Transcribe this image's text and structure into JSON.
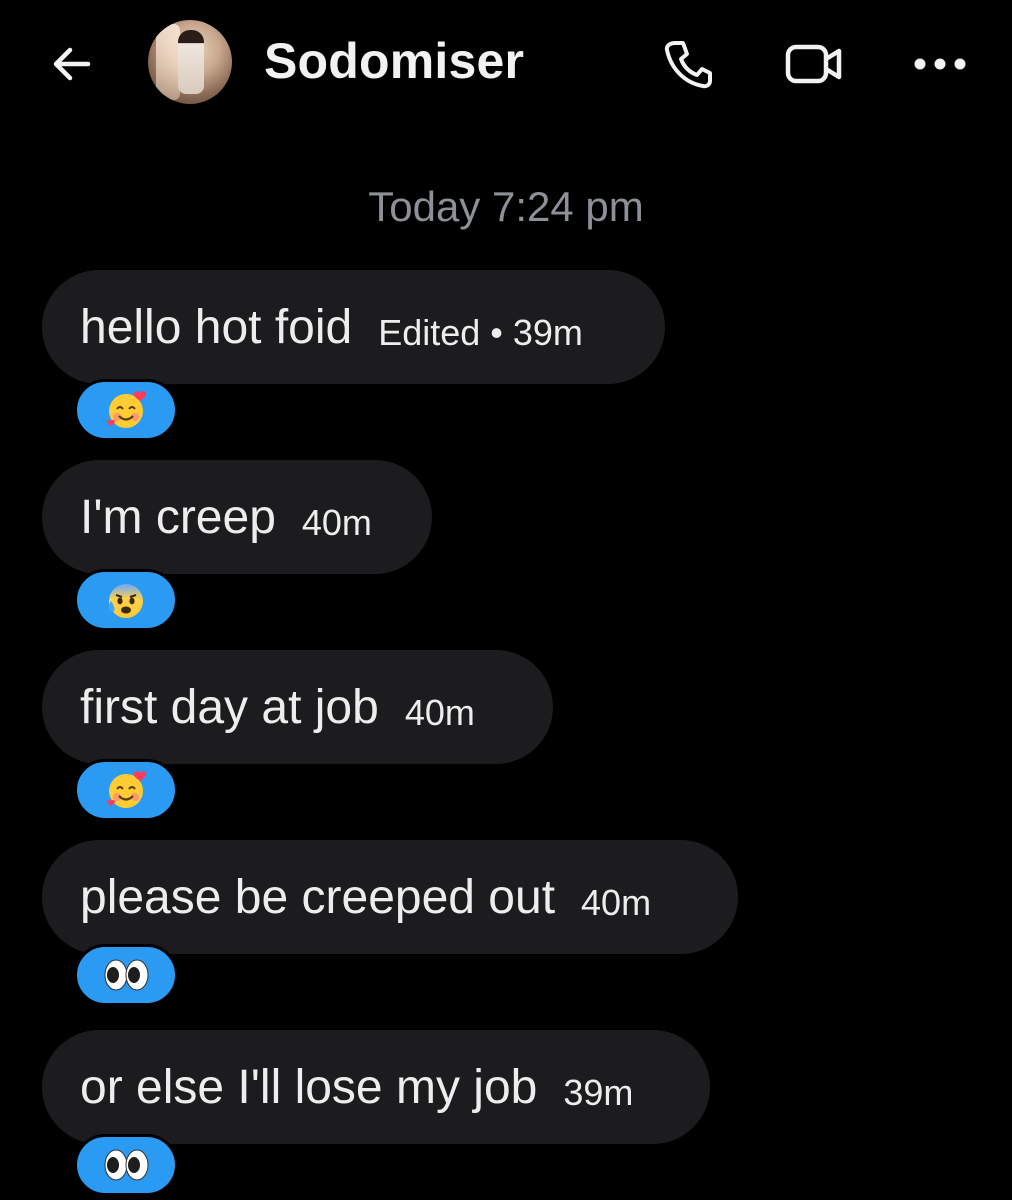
{
  "header": {
    "contact_name": "Sodomiser",
    "back_icon": "arrow-left-icon",
    "call_icon": "phone-icon",
    "video_icon": "video-camera-icon",
    "more_icon": "more-horizontal-icon"
  },
  "conversation": {
    "day_stamp": "Today 7:24 pm",
    "messages": [
      {
        "text": "hello hot foid",
        "meta": "Edited • 39m",
        "reaction": "smiling-face-with-hearts"
      },
      {
        "text": "I'm creep",
        "meta": "40m",
        "reaction": "anxious-face-with-sweat"
      },
      {
        "text": "first day at job",
        "meta": "40m",
        "reaction": "smiling-face-with-hearts"
      },
      {
        "text": "please be creeped out",
        "meta": "40m",
        "reaction": "eyes"
      },
      {
        "text": "or else I'll lose my job",
        "meta": "39m",
        "reaction": "eyes"
      }
    ]
  },
  "colors": {
    "background": "#000000",
    "bubble": "#1c1c1f",
    "reaction_bg": "#2b9af3",
    "timestamp": "#8d9096"
  }
}
